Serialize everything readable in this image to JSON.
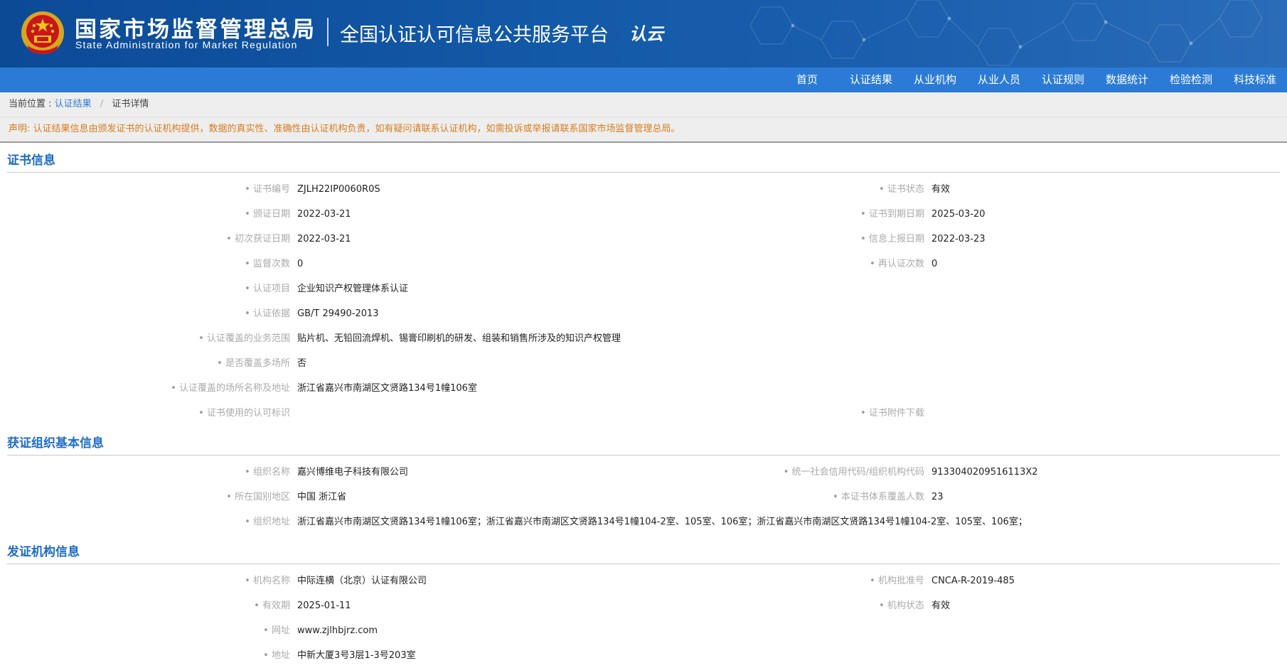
{
  "header": {
    "org_cn": "国家市场监督管理总局",
    "org_en": "State Administration  for  Market Regulation",
    "platform_title": "全国认证认可信息公共服务平台",
    "platform_logo": "认云"
  },
  "nav": {
    "items": [
      "首页",
      "认证结果",
      "从业机构",
      "从业人员",
      "认证规则",
      "数据统计",
      "检验检测",
      "科技标准"
    ]
  },
  "breadcrumb": {
    "prefix": "当前位置 :",
    "link": "认证结果",
    "separator": "/",
    "current": "证书详情"
  },
  "notice": "声明: 认证结果信息由颁发证书的认证机构提供，数据的真实性、准确性由认证机构负责，如有疑问请联系认证机构，如需投诉或举报请联系国家市场监督管理总局。",
  "cert_info": {
    "title": "证书信息",
    "rows": [
      {
        "l1": "证书编号",
        "v1": "ZJLH22IP0060R0S",
        "l2": "证书状态",
        "v2": "有效"
      },
      {
        "l1": "颁证日期",
        "v1": "2022-03-21",
        "l2": "证书到期日期",
        "v2": "2025-03-20"
      },
      {
        "l1": "初次获证日期",
        "v1": "2022-03-21",
        "l2": "信息上报日期",
        "v2": "2022-03-23"
      },
      {
        "l1": "监督次数",
        "v1": "0",
        "l2": "再认证次数",
        "v2": "0"
      },
      {
        "l1": "认证项目",
        "v1": "企业知识产权管理体系认证"
      },
      {
        "l1": "认证依据",
        "v1": "GB/T 29490-2013"
      },
      {
        "l1": "认证覆盖的业务范围",
        "v1": "贴片机、无铅回流焊机、锡膏印刷机的研发、组装和销售所涉及的知识产权管理"
      },
      {
        "l1": "是否覆盖多场所",
        "v1": "否"
      },
      {
        "l1": "认证覆盖的场所名称及地址",
        "v1": "浙江省嘉兴市南湖区文贤路134号1幢106室"
      },
      {
        "l1": "证书使用的认可标识",
        "v1": "",
        "l2": "证书附件下载",
        "v2": ""
      }
    ]
  },
  "org_info": {
    "title": "获证组织基本信息",
    "rows": [
      {
        "l1": "组织名称",
        "v1": "嘉兴博维电子科技有限公司",
        "l2": "统一社会信用代码/组织机构代码",
        "v2": "9133040209516113X2"
      },
      {
        "l1": "所在国别地区",
        "v1": "中国 浙江省",
        "l2": "本证书体系覆盖人数",
        "v2": "23"
      },
      {
        "l1": "组织地址",
        "v1": "浙江省嘉兴市南湖区文贤路134号1幢106室；浙江省嘉兴市南湖区文贤路134号1幢104-2室、105室、106室；浙江省嘉兴市南湖区文贤路134号1幢104-2室、105室、106室；"
      }
    ]
  },
  "issuer_info": {
    "title": "发证机构信息",
    "rows": [
      {
        "l1": "机构名称",
        "v1": "中际连横（北京）认证有限公司",
        "l2": "机构批准号",
        "v2": "CNCA-R-2019-485"
      },
      {
        "l1": "有效期",
        "v1": "2025-01-11",
        "l2": "机构状态",
        "v2": "有效"
      },
      {
        "l1": "网址",
        "v1": "www.zjlhbjrz.com"
      },
      {
        "l1": "地址",
        "v1": "中新大厦3号3层1-3号203室"
      }
    ]
  }
}
